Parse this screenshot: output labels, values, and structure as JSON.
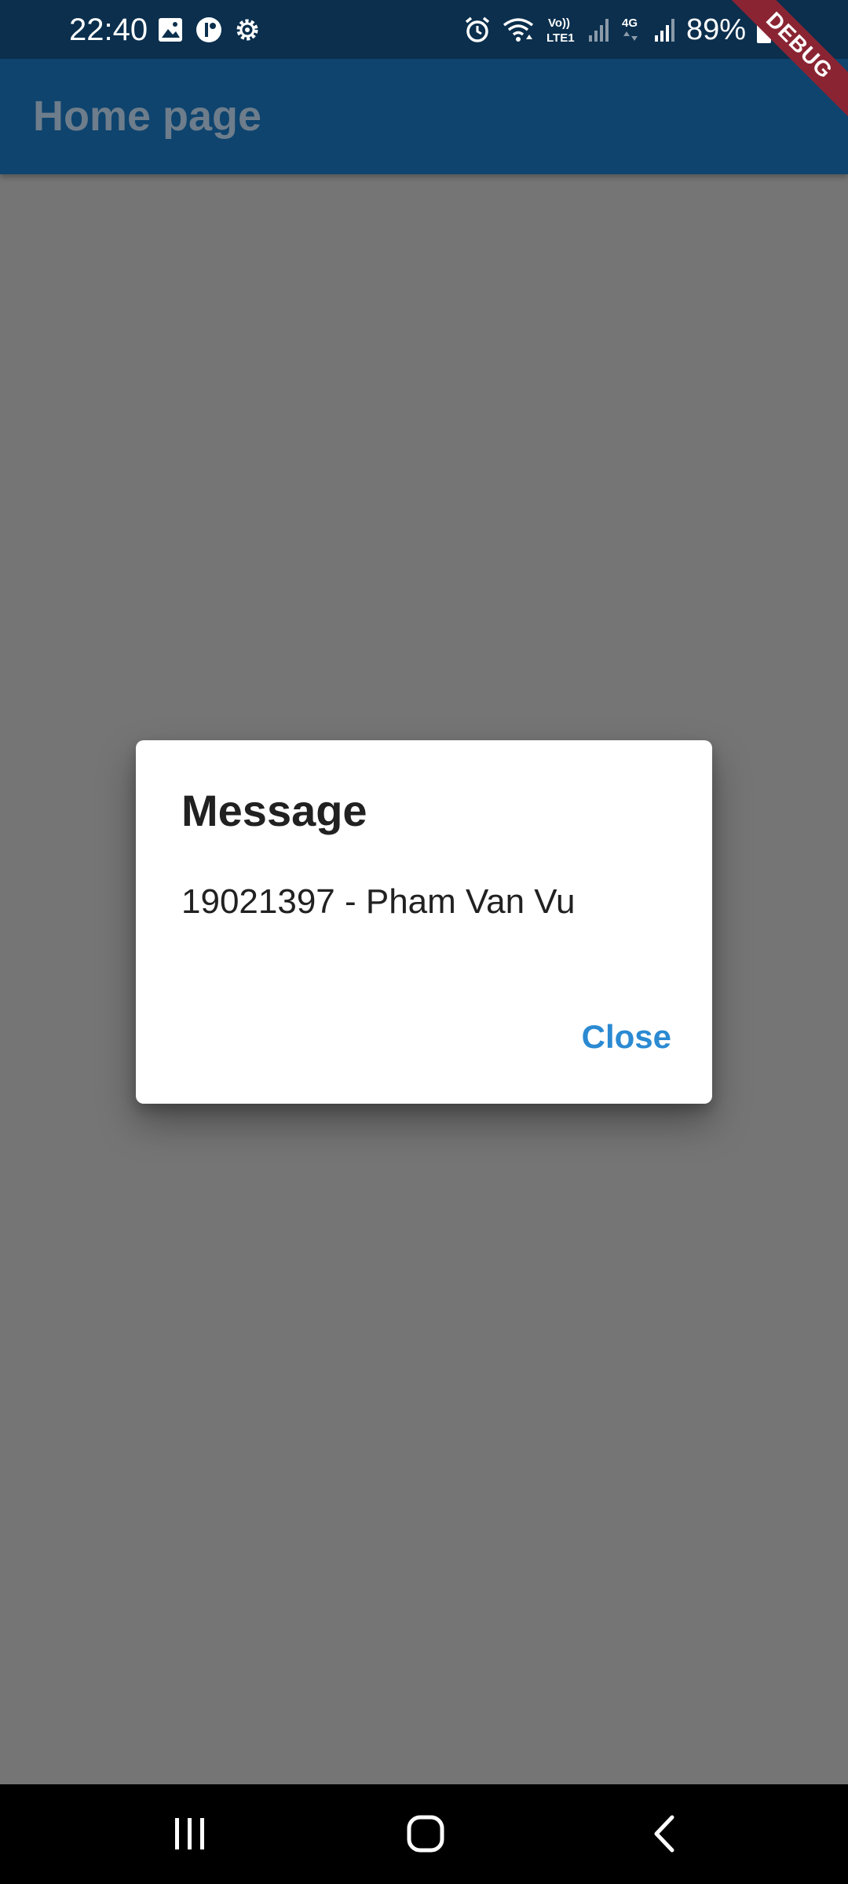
{
  "status_bar": {
    "time": "22:40",
    "battery": "89%",
    "left_icons": [
      "image-icon",
      "circle-app-icon",
      "gear-icon"
    ],
    "right_icons": [
      "alarm-icon",
      "wifi-icon",
      "volte-icon",
      "signal-icon",
      "4g-icon",
      "signal-icon",
      "battery-icon"
    ]
  },
  "app_bar": {
    "title": "Home page"
  },
  "debug_banner": {
    "label": "DEBUG"
  },
  "dialog": {
    "title": "Message",
    "content": "19021397 - Pham Van Vu",
    "close_label": "Close"
  },
  "nav_bar": {
    "icons": [
      "recent-apps-icon",
      "home-icon",
      "back-icon"
    ]
  },
  "colors": {
    "status_bar_bg": "#0b2f4d",
    "app_bar_bg": "#0e446e",
    "scrim_bg": "#757575",
    "accent": "#2b8ad2",
    "debug_ribbon": "#8a2433"
  }
}
